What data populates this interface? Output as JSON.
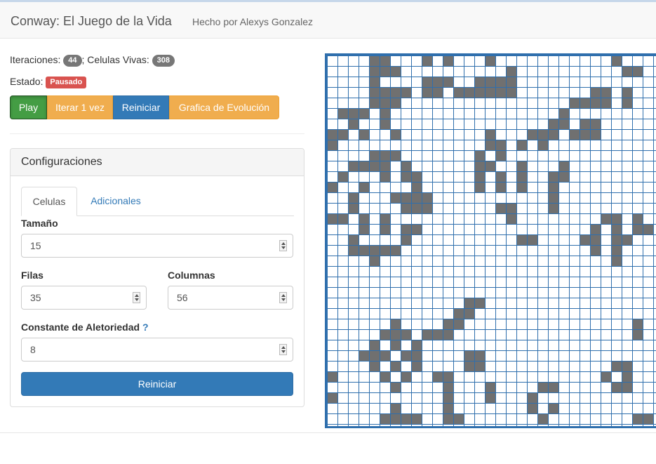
{
  "navbar": {
    "brand": "Conway: El Juego de la Vida",
    "author": "Hecho por Alexys Gonzalez"
  },
  "stats": {
    "iterations_label": "Iteraciones:",
    "iterations": "44",
    "separator": ";",
    "alive_label": "Celulas Vivas:",
    "alive": "308",
    "state_label": "Estado:",
    "state": "Pausado"
  },
  "toolbar": {
    "play": "Play",
    "step": "Iterar 1 vez",
    "reset": "Reiniciar",
    "chart": "Grafica de Evolución"
  },
  "config": {
    "title": "Configuraciones",
    "tabs": [
      "Celulas",
      "Adicionales"
    ],
    "size_label": "Tamaño",
    "size_value": "15",
    "rows_label": "Filas",
    "rows_value": "35",
    "cols_label": "Columnas",
    "cols_value": "56",
    "random_label": "Constante de Aletoriedad",
    "random_help": "?",
    "random_value": "8",
    "reset_button": "Reiniciar"
  },
  "grid": {
    "visible_rows": 35,
    "visible_cols": 31,
    "colors": {
      "alive": "#707070",
      "dead": "#ffffff",
      "line": "#2f6fad"
    },
    "alive_cells": [
      [
        0,
        4
      ],
      [
        0,
        5
      ],
      [
        0,
        9
      ],
      [
        0,
        11
      ],
      [
        0,
        15
      ],
      [
        0,
        27
      ],
      [
        1,
        4
      ],
      [
        1,
        5
      ],
      [
        1,
        6
      ],
      [
        1,
        17
      ],
      [
        1,
        28
      ],
      [
        1,
        29
      ],
      [
        2,
        4
      ],
      [
        2,
        9
      ],
      [
        2,
        10
      ],
      [
        2,
        11
      ],
      [
        2,
        14
      ],
      [
        2,
        15
      ],
      [
        2,
        16
      ],
      [
        2,
        17
      ],
      [
        3,
        4
      ],
      [
        3,
        5
      ],
      [
        3,
        6
      ],
      [
        3,
        7
      ],
      [
        3,
        9
      ],
      [
        3,
        10
      ],
      [
        3,
        12
      ],
      [
        3,
        13
      ],
      [
        3,
        14
      ],
      [
        3,
        15
      ],
      [
        3,
        16
      ],
      [
        3,
        17
      ],
      [
        3,
        25
      ],
      [
        3,
        26
      ],
      [
        3,
        28
      ],
      [
        4,
        4
      ],
      [
        4,
        5
      ],
      [
        4,
        6
      ],
      [
        4,
        23
      ],
      [
        4,
        24
      ],
      [
        4,
        25
      ],
      [
        4,
        26
      ],
      [
        4,
        28
      ],
      [
        5,
        1
      ],
      [
        5,
        2
      ],
      [
        5,
        3
      ],
      [
        5,
        5
      ],
      [
        5,
        22
      ],
      [
        6,
        2
      ],
      [
        6,
        5
      ],
      [
        6,
        21
      ],
      [
        6,
        22
      ],
      [
        6,
        24
      ],
      [
        6,
        25
      ],
      [
        7,
        0
      ],
      [
        7,
        1
      ],
      [
        7,
        3
      ],
      [
        7,
        6
      ],
      [
        7,
        15
      ],
      [
        7,
        19
      ],
      [
        7,
        20
      ],
      [
        7,
        21
      ],
      [
        7,
        23
      ],
      [
        7,
        24
      ],
      [
        7,
        25
      ],
      [
        8,
        0
      ],
      [
        8,
        15
      ],
      [
        8,
        16
      ],
      [
        8,
        18
      ],
      [
        8,
        20
      ],
      [
        9,
        4
      ],
      [
        9,
        5
      ],
      [
        9,
        6
      ],
      [
        9,
        14
      ],
      [
        9,
        16
      ],
      [
        10,
        2
      ],
      [
        10,
        3
      ],
      [
        10,
        4
      ],
      [
        10,
        5
      ],
      [
        10,
        7
      ],
      [
        10,
        14
      ],
      [
        10,
        15
      ],
      [
        10,
        18
      ],
      [
        10,
        22
      ],
      [
        11,
        1
      ],
      [
        11,
        5
      ],
      [
        11,
        7
      ],
      [
        11,
        8
      ],
      [
        11,
        14
      ],
      [
        11,
        16
      ],
      [
        11,
        18
      ],
      [
        11,
        21
      ],
      [
        11,
        22
      ],
      [
        12,
        0
      ],
      [
        12,
        3
      ],
      [
        12,
        8
      ],
      [
        12,
        14
      ],
      [
        12,
        16
      ],
      [
        12,
        18
      ],
      [
        12,
        21
      ],
      [
        13,
        2
      ],
      [
        13,
        6
      ],
      [
        13,
        7
      ],
      [
        13,
        8
      ],
      [
        13,
        9
      ],
      [
        13,
        21
      ],
      [
        14,
        2
      ],
      [
        14,
        7
      ],
      [
        14,
        8
      ],
      [
        14,
        9
      ],
      [
        14,
        16
      ],
      [
        14,
        17
      ],
      [
        14,
        21
      ],
      [
        15,
        0
      ],
      [
        15,
        1
      ],
      [
        15,
        3
      ],
      [
        15,
        5
      ],
      [
        15,
        17
      ],
      [
        15,
        26
      ],
      [
        15,
        27
      ],
      [
        15,
        29
      ],
      [
        16,
        3
      ],
      [
        16,
        5
      ],
      [
        16,
        7
      ],
      [
        16,
        8
      ],
      [
        16,
        25
      ],
      [
        16,
        27
      ],
      [
        16,
        29
      ],
      [
        16,
        30
      ],
      [
        17,
        2
      ],
      [
        17,
        7
      ],
      [
        17,
        18
      ],
      [
        17,
        19
      ],
      [
        17,
        24
      ],
      [
        17,
        25
      ],
      [
        17,
        27
      ],
      [
        17,
        28
      ],
      [
        18,
        2
      ],
      [
        18,
        3
      ],
      [
        18,
        4
      ],
      [
        18,
        5
      ],
      [
        18,
        6
      ],
      [
        18,
        25
      ],
      [
        18,
        27
      ],
      [
        19,
        4
      ],
      [
        19,
        27
      ],
      [
        23,
        13
      ],
      [
        23,
        14
      ],
      [
        24,
        12
      ],
      [
        24,
        13
      ],
      [
        25,
        6
      ],
      [
        25,
        11
      ],
      [
        25,
        12
      ],
      [
        25,
        29
      ],
      [
        26,
        5
      ],
      [
        26,
        6
      ],
      [
        26,
        7
      ],
      [
        26,
        9
      ],
      [
        26,
        10
      ],
      [
        26,
        11
      ],
      [
        26,
        29
      ],
      [
        27,
        4
      ],
      [
        27,
        6
      ],
      [
        27,
        8
      ],
      [
        28,
        3
      ],
      [
        28,
        4
      ],
      [
        28,
        5
      ],
      [
        28,
        7
      ],
      [
        28,
        8
      ],
      [
        28,
        13
      ],
      [
        28,
        14
      ],
      [
        29,
        4
      ],
      [
        29,
        6
      ],
      [
        29,
        8
      ],
      [
        29,
        13
      ],
      [
        29,
        14
      ],
      [
        29,
        27
      ],
      [
        29,
        28
      ],
      [
        30,
        0
      ],
      [
        30,
        5
      ],
      [
        30,
        7
      ],
      [
        30,
        10
      ],
      [
        30,
        11
      ],
      [
        30,
        26
      ],
      [
        30,
        28
      ],
      [
        31,
        6
      ],
      [
        31,
        11
      ],
      [
        31,
        15
      ],
      [
        31,
        20
      ],
      [
        31,
        21
      ],
      [
        31,
        27
      ],
      [
        31,
        28
      ],
      [
        32,
        0
      ],
      [
        32,
        11
      ],
      [
        32,
        15
      ],
      [
        32,
        19
      ],
      [
        33,
        6
      ],
      [
        33,
        11
      ],
      [
        33,
        19
      ],
      [
        33,
        21
      ],
      [
        34,
        5
      ],
      [
        34,
        6
      ],
      [
        34,
        7
      ],
      [
        34,
        8
      ],
      [
        34,
        11
      ],
      [
        34,
        12
      ],
      [
        34,
        20
      ],
      [
        34,
        29
      ],
      [
        34,
        30
      ]
    ]
  }
}
